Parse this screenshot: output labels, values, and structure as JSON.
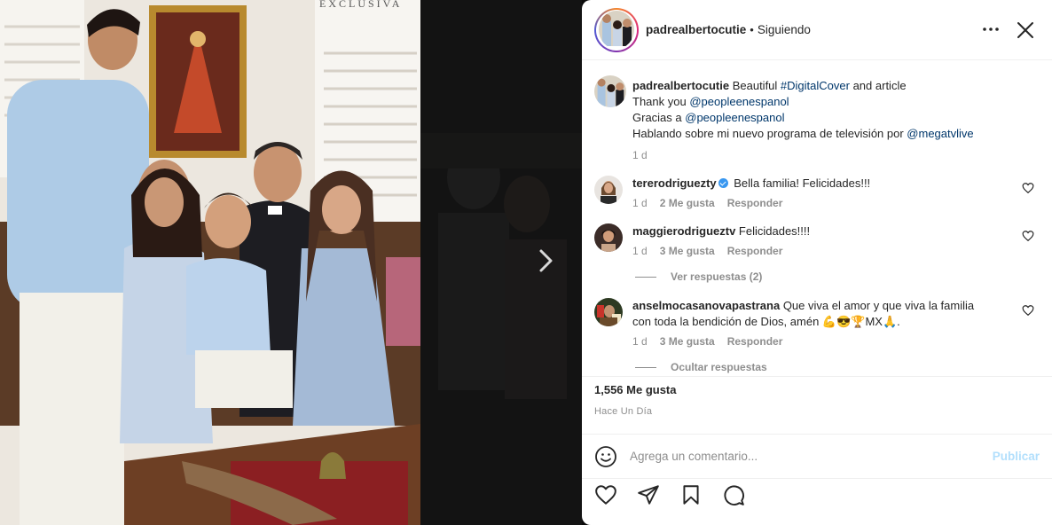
{
  "photo": {
    "alt_logo": "EXCLUSIVA"
  },
  "header": {
    "username": "padrealbertocutie",
    "separator": "•",
    "follow_status": "Siguiendo"
  },
  "caption": {
    "username": "padrealbertocutie",
    "line1_text": " Beautiful ",
    "line1_hashtag": "#DigitalCover",
    "line1_rest": " and article",
    "line2_text": "Thank you ",
    "line2_mention": "@peopleenespanol",
    "line3_text": "Gracias a ",
    "line3_mention": "@peopleenespanol",
    "line4_text": "Hablando sobre mi nuevo programa de televisión por ",
    "line4_mention": "@megatvlive",
    "age": "1 d"
  },
  "comments": [
    {
      "username": "tererodriguezty",
      "verified": true,
      "text": "Bella familia! Felicidades!!!",
      "age": "1 d",
      "likes": "2 Me gusta",
      "reply": "Responder"
    },
    {
      "username": "maggierodrigueztv",
      "verified": false,
      "text": "Felicidades!!!!",
      "age": "1 d",
      "likes": "3 Me gusta",
      "reply": "Responder",
      "view_replies": "Ver respuestas (2)"
    },
    {
      "username": "anselmocasanovapastrana",
      "verified": false,
      "text_line1": " Que viva el amor y que viva la familia",
      "text_line2": "con toda la bendición de Dios, amén 💪😎🏆MX🙏.",
      "age": "1 d",
      "likes": "3 Me gusta",
      "reply": "Responder",
      "hide_replies": "Ocultar respuestas"
    }
  ],
  "footer": {
    "likes": "1,556 Me gusta",
    "time": "Hace Un Día",
    "comment_placeholder": "Agrega un comentario...",
    "publish_label": "Publicar"
  },
  "colors": {
    "link": "#00376b",
    "verified": "#3897f0",
    "publish_disabled": "#b2dffc",
    "muted": "#8e8e8e"
  }
}
